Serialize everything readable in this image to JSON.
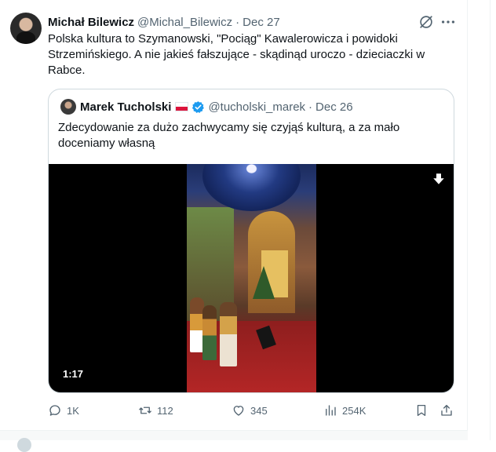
{
  "tweet": {
    "author_name": "Michał Bilewicz",
    "author_handle": "@Michal_Bilewicz",
    "separator": "·",
    "date": "Dec 27",
    "text": "Polska kultura to Szymanowski, \"Pociąg\" Kawalerowicza i powidoki Strzemińskiego. A nie jakieś fałszujące - skądinąd uroczo - dzieciaczki w Rabce."
  },
  "quote": {
    "author_name": "Marek Tucholski",
    "author_handle": "@tucholski_marek",
    "separator": "·",
    "date": "Dec 26",
    "flag": "poland-flag",
    "verified_color": "#1d9bf0",
    "text": "Zdecydowanie za dużo zachwycamy się czyjąś kulturą, a za mało doceniamy własną",
    "video": {
      "duration": "1:17"
    }
  },
  "actions": {
    "replies": "1K",
    "retweets": "112",
    "likes": "345",
    "views": "254K"
  },
  "colors": {
    "text": "#0f1419",
    "secondary": "#536471",
    "border": "#cfd9de",
    "accent": "#1d9bf0"
  },
  "icons": [
    "grok-icon",
    "more-icon",
    "verified-icon",
    "download-icon",
    "reply-icon",
    "retweet-icon",
    "like-icon",
    "views-icon",
    "bookmark-icon",
    "share-icon"
  ]
}
